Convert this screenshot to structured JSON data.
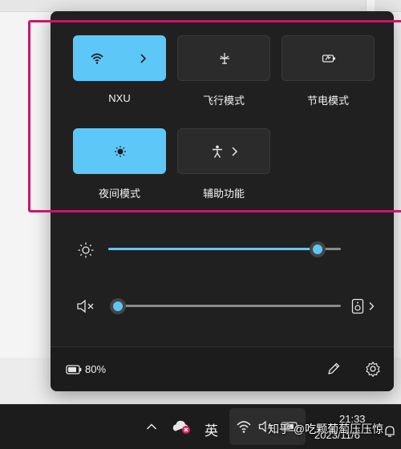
{
  "quick_settings": {
    "tiles": [
      {
        "label": "NXU",
        "icon": "wifi-icon",
        "active": true,
        "has_chevron": true
      },
      {
        "label": "飞行模式",
        "icon": "airplane-icon",
        "active": false,
        "has_chevron": false
      },
      {
        "label": "节电模式",
        "icon": "battery-saver-icon",
        "active": false,
        "has_chevron": false
      },
      {
        "label": "夜间模式",
        "icon": "night-light-icon",
        "active": true,
        "has_chevron": false
      },
      {
        "label": "辅助功能",
        "icon": "accessibility-icon",
        "active": false,
        "has_chevron": true
      }
    ],
    "brightness": {
      "icon": "brightness-icon",
      "level": 0.9
    },
    "volume": {
      "icon": "speaker-muted-icon",
      "level": 0.0,
      "output_icon": "speaker-output-icon"
    },
    "footer": {
      "battery_icon": "battery-icon",
      "battery_text": "80%",
      "edit_icon": "pencil-icon",
      "settings_icon": "gear-icon"
    }
  },
  "taskbar": {
    "ime_label": "英",
    "time": "21:33",
    "date": "2023/11/6"
  },
  "watermark": "知乎 @吃颗葡萄压压惊",
  "colors": {
    "accent": "#5dc8f7",
    "panel": "#202020",
    "annotation": "#c4186a"
  }
}
